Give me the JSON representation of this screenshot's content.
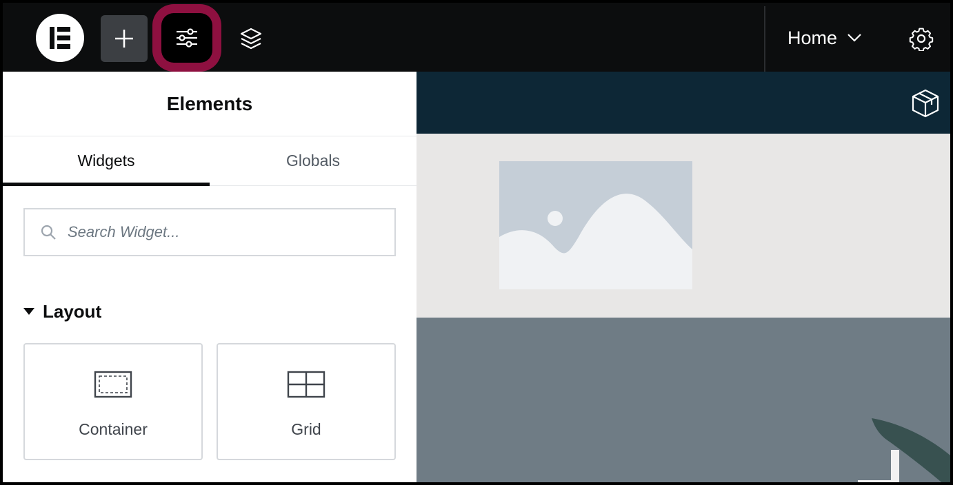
{
  "topbar": {
    "logo_icon": "elementor-logo-icon",
    "add_icon": "plus-icon",
    "site_settings_icon": "sliders-icon",
    "structure_icon": "layers-icon",
    "page_name": "Home",
    "page_dropdown_icon": "chevron-down-icon",
    "settings_icon": "gear-icon",
    "highlight_color": "#8e1040"
  },
  "panel": {
    "title": "Elements",
    "tabs": [
      {
        "label": "Widgets",
        "active": true
      },
      {
        "label": "Globals",
        "active": false
      }
    ],
    "search": {
      "placeholder": "Search Widget...",
      "value": ""
    },
    "section": {
      "title": "Layout",
      "expanded": true
    },
    "widgets": [
      {
        "label": "Container",
        "icon": "container-icon"
      },
      {
        "label": "Grid",
        "icon": "grid-icon"
      }
    ]
  },
  "canvas": {
    "header_icon": "cube-icon",
    "image": "image-placeholder-icon",
    "colors": {
      "header": "#0d2736",
      "light_section": "#e8e7e6",
      "dark_section": "#6f7c85"
    }
  }
}
